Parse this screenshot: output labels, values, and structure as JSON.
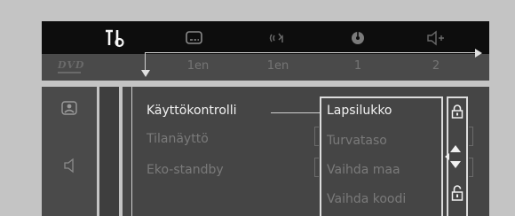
{
  "tabs": [
    {
      "icon": "tools-icon",
      "active": true
    },
    {
      "icon": "subtitle-icon",
      "active": false
    },
    {
      "icon": "audio-wave-icon",
      "active": false
    },
    {
      "icon": "disc-angle-icon",
      "active": false
    },
    {
      "icon": "speaker-icon",
      "active": false
    }
  ],
  "info_bar": {
    "logo": "DVD",
    "values": [
      "1en",
      "1en",
      "1",
      "2"
    ]
  },
  "side_icons": [
    "person-icon",
    "speaker-icon"
  ],
  "menu": {
    "items": [
      {
        "label": "Käyttökontrolli",
        "state": "selected"
      },
      {
        "label": "Tilanäyttö",
        "state": "normal"
      },
      {
        "label": "Eko-standby",
        "state": "normal"
      }
    ]
  },
  "submenu": {
    "items": [
      {
        "label": "Lapsilukko",
        "state": "highlighted"
      },
      {
        "label": "Turvataso",
        "state": "normal"
      },
      {
        "label": "Vaihda maa",
        "state": "normal"
      },
      {
        "label": "Vaihda koodi",
        "state": "normal"
      }
    ],
    "icons": [
      "lock-icon",
      "up-down-arrow-icon",
      "lock-icon"
    ]
  },
  "colors": {
    "bright_text": "#f2f2f2",
    "dim_text": "#7a7a7a",
    "tab_bar": "#0d0d0d",
    "panel": "#454545",
    "background": "#c4c4c4"
  }
}
